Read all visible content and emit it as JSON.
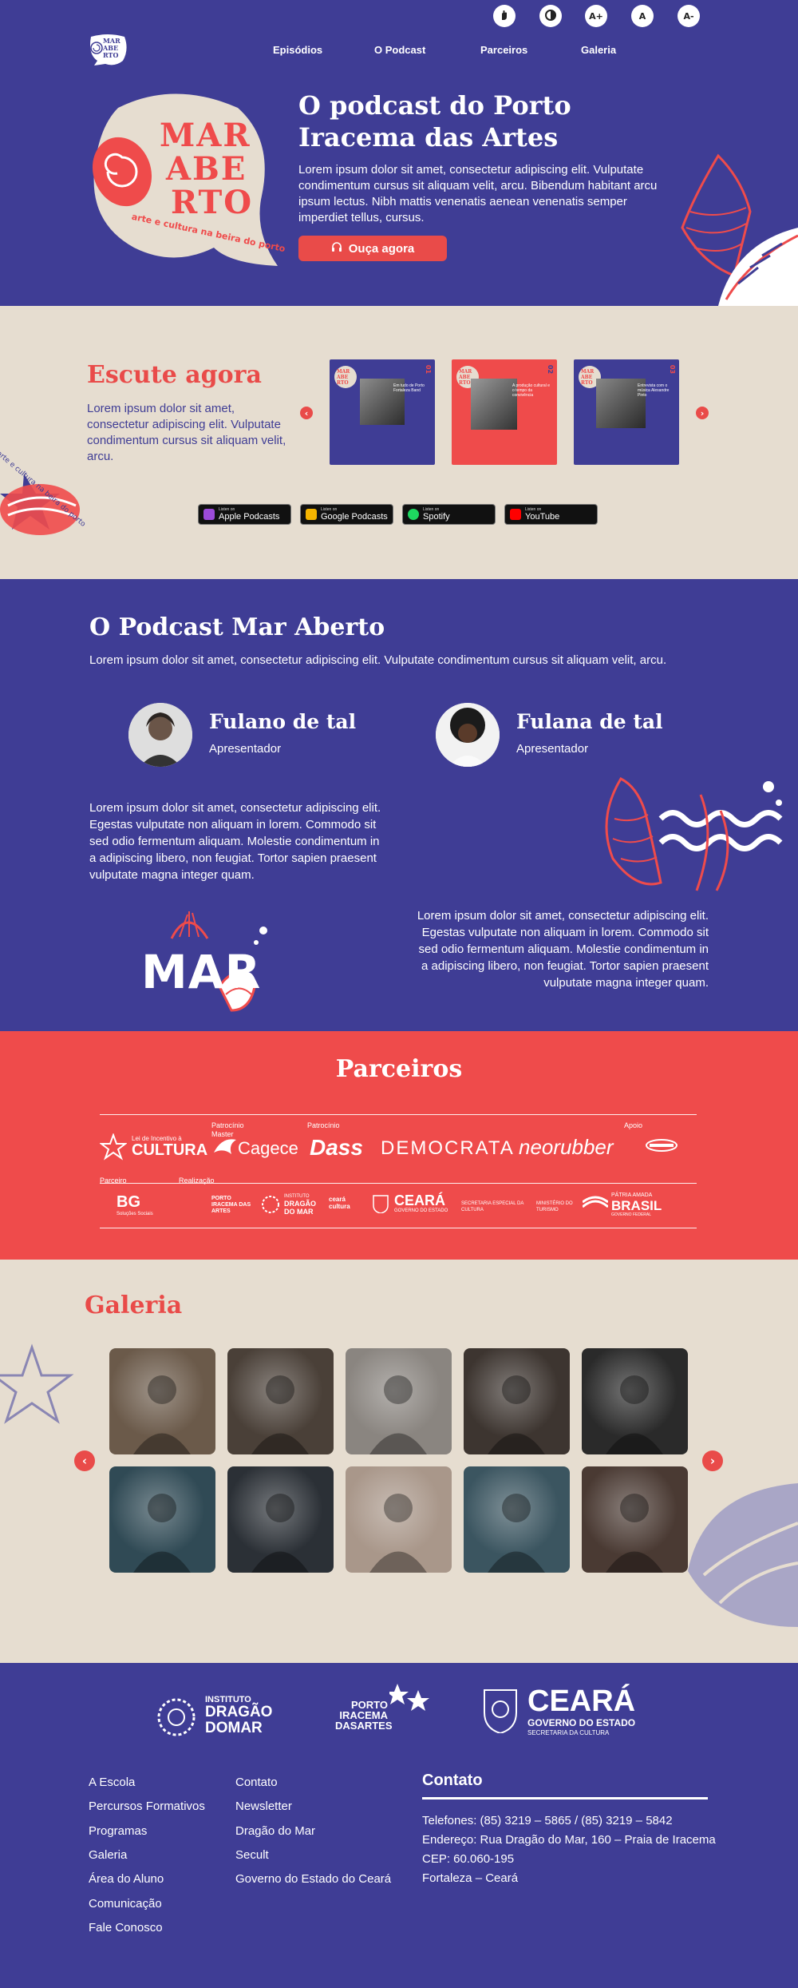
{
  "colors": {
    "brand_purple": "#3f3d95",
    "accent_red": "#e94b49",
    "sand": "#e6ddd0",
    "white": "#ffffff"
  },
  "accessibility": [
    {
      "name": "accessibility-vlibras-button",
      "icon": "hand-sign-icon",
      "label": ""
    },
    {
      "name": "contrast-toggle-button",
      "icon": "contrast-icon",
      "label": ""
    },
    {
      "name": "font-increase-button",
      "icon": "",
      "label": "A+"
    },
    {
      "name": "font-reset-button",
      "icon": "",
      "label": "A"
    },
    {
      "name": "font-decrease-button",
      "icon": "",
      "label": "A-"
    }
  ],
  "logo": {
    "lines": [
      "MAR",
      "ABE",
      "RTO"
    ]
  },
  "nav": [
    {
      "label": "Episódios"
    },
    {
      "label": "O Podcast"
    },
    {
      "label": "Parceiros"
    },
    {
      "label": "Galeria"
    }
  ],
  "hero": {
    "badge_lines": [
      "MAR",
      "ABE",
      "RTO"
    ],
    "badge_tagline": "arte e cultura na beira do porto",
    "title": "O podcast do Porto Iracema das Artes",
    "text": "Lorem ipsum dolor sit amet, consectetur adipiscing elit. Vulputate condimentum cursus sit aliquam velit, arcu. Bibendum habitant arcu ipsum lectus. Nibh mattis venenatis aenean venenatis semper imperdiet tellus, cursus.",
    "cta": "Ouça agora",
    "cta_icon": "headphones-icon"
  },
  "listen": {
    "title": "Escute agora",
    "text": "Lorem ipsum dolor sit amet, consectetur adipiscing elit. Vulputate condimentum cursus sit aliquam velit, arcu.",
    "side_text": "arte e cultura na beira do porto",
    "episodes": [
      {
        "bg": "#3f3d95",
        "caption": "Em tudo de Porto Fortaleza Band",
        "num": "01"
      },
      {
        "bg": "#ef4b4b",
        "caption": "A produção cultural e o tempo da convivência",
        "num": "02"
      },
      {
        "bg": "#3f3d95",
        "caption": "Entrevista com o música Alexandre Pinto",
        "num": "03"
      }
    ],
    "platforms": [
      {
        "small": "Listen on",
        "large": "Apple Podcasts",
        "color": "#9c4bd9"
      },
      {
        "small": "Listen on",
        "large": "Google Podcasts",
        "color": "#f4b400"
      },
      {
        "small": "Listen on",
        "large": "Spotify",
        "color": "#1ed760"
      },
      {
        "small": "Listen on",
        "large": "YouTube",
        "color": "#ff0000"
      }
    ]
  },
  "about": {
    "title": "O Podcast Mar Aberto",
    "subtitle": "Lorem ipsum dolor sit amet, consectetur adipiscing elit. Vulputate condimentum cursus sit aliquam velit, arcu.",
    "hosts": [
      {
        "name": "Fulano de tal",
        "role": "Apresentador"
      },
      {
        "name": "Fulana de tal",
        "role": "Apresentador"
      }
    ],
    "para1": "Lorem ipsum dolor sit amet, consectetur adipiscing elit. Egestas vulputate non aliquam in lorem. Commodo sit sed odio fermentum aliquam. Molestie condimentum in a adipiscing libero, non feugiat. Tortor sapien praesent vulputate magna integer quam.",
    "para2": "Lorem ipsum dolor sit amet, consectetur adipiscing elit. Egestas vulputate non aliquam in lorem. Commodo sit sed odio fermentum aliquam. Molestie condimentum in a adipiscing libero, non feugiat. Tortor sapien praesent vulputate magna integer quam.",
    "mar_logo": "MAR"
  },
  "partners": {
    "title": "Parceiros",
    "labels": {
      "patrocinio_master": "Patrocínio Master",
      "patrocinio": "Patrocínio",
      "apoio": "Apoio",
      "parceiro": "Parceiro",
      "realizacao": "Realização"
    },
    "row1": {
      "lei_small": "Lei de Incentivo à",
      "lei_large": "CULTURA",
      "cagece": "Cagece",
      "dass": "Dass",
      "dass_small": "",
      "democrata": "DEMOCRATA",
      "neorubber": "neorubber",
      "apoio_logo": ""
    },
    "row2": {
      "bg": "BG",
      "bg_small": "Soluções Sociais",
      "porto": "PORTO IRACEMA DAS ARTES",
      "dragao": "DRAGÃO DO MAR",
      "dragao_small": "INSTITUTO",
      "ceara_cultura": "ceará cultura",
      "ceara": "CEARÁ",
      "ceara_small": "GOVERNO DO ESTADO",
      "secretaria": "SECRETARIA ESPECIAL DA CULTURA",
      "ministerio": "MINISTÉRIO DO TURISMO",
      "patria_small": "PÁTRIA AMADA",
      "brasil": "BRASIL",
      "brasil_small": "GOVERNO FEDERAL"
    }
  },
  "gallery": {
    "title": "Galeria",
    "items": [
      {
        "bg": "#6b5a4a",
        "desc": "man-headphones-mic-icon"
      },
      {
        "bg": "#4a4038",
        "desc": "woman-headphones-icon"
      },
      {
        "bg": "#8a8580",
        "desc": "mic-closeup-icon"
      },
      {
        "bg": "#3d3530",
        "desc": "man-desk-icon"
      },
      {
        "bg": "#2a2a2a",
        "desc": "studio-mic-icon"
      },
      {
        "bg": "#304a55",
        "desc": "control-room-icon"
      },
      {
        "bg": "#2b3036",
        "desc": "mixer-icon"
      },
      {
        "bg": "#a9978a",
        "desc": "empty-studio-icon"
      },
      {
        "bg": "#3b5560",
        "desc": "woman-singing-icon"
      },
      {
        "bg": "#4a3a33",
        "desc": "man-headphones-icon"
      }
    ]
  },
  "footer": {
    "logos": {
      "dragao_small": "INSTITUTO",
      "dragao_large1": "DRAGÃO",
      "dragao_large2": "DOMAR",
      "porto1": "PORTO",
      "porto2": "IRACEMA",
      "porto3": "DASARTES",
      "ceara": "CEARÁ",
      "ceara_sub": "GOVERNO DO ESTADO",
      "ceara_sub2": "SECRETARIA DA CULTURA"
    },
    "col1": [
      "A Escola",
      "Percursos Formativos",
      "Programas",
      "Galeria",
      "Área do Aluno",
      "Comunicação",
      "Fale Conosco"
    ],
    "col2": [
      "Contato",
      "Newsletter",
      "Dragão do Mar",
      "Secult",
      "Governo do Estado do Ceará"
    ],
    "contact_title": "Contato",
    "contact_lines": [
      "Telefones: (85) 3219 – 5865 / (85) 3219 – 5842",
      "Endereço: Rua Dragão do Mar, 160 – Praia de Iracema",
      "CEP: 60.060-195",
      "Fortaleza – Ceará"
    ]
  }
}
